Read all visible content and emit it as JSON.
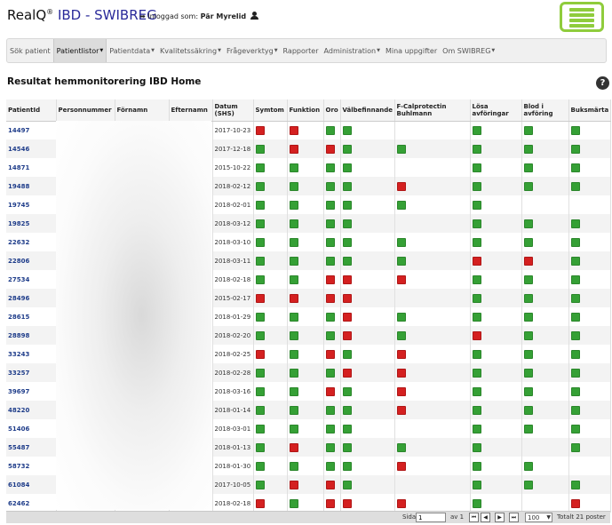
{
  "header": {
    "brand_name": "RealQ",
    "brand_reg": "®",
    "app_name": "IBD - SWIBREG",
    "logged_in_label": "Inloggad som:",
    "user_name": "Pär Myrelid"
  },
  "nav": {
    "items": [
      {
        "label": "Sök patient",
        "dropdown": false
      },
      {
        "label": "Patientlistor",
        "dropdown": true
      },
      {
        "label": "Patientdata",
        "dropdown": true
      },
      {
        "label": "Kvalitetssäkring",
        "dropdown": true
      },
      {
        "label": "Frågeverktyg",
        "dropdown": true
      },
      {
        "label": "Rapporter",
        "dropdown": false
      },
      {
        "label": "Administration",
        "dropdown": true
      },
      {
        "label": "Mina uppgifter",
        "dropdown": false
      },
      {
        "label": "Om SWIBREG",
        "dropdown": true
      }
    ],
    "active_index": 1,
    "caret": "▼"
  },
  "page": {
    "title": "Resultat hemmonitorering IBD Home",
    "help_symbol": "?"
  },
  "table": {
    "headers": [
      "PatientId",
      "Personnummer",
      "Förnamn",
      "Efternamn",
      "Datum (SHS)",
      "Symtom",
      "Funktion",
      "Oro",
      "Välbefinnande",
      "F-Calprotectin Buhlmann",
      "Lösa avföringar",
      "Blod i avföring",
      "Buksmärta"
    ],
    "status_colors": {
      "g": "#35a035",
      "r": "#d42020"
    },
    "rows": [
      {
        "id": "14497",
        "date": "2017-10-23",
        "s": [
          "r",
          "r",
          "g",
          "g",
          "",
          "g",
          "g",
          "g"
        ]
      },
      {
        "id": "14546",
        "date": "2017-12-18",
        "s": [
          "g",
          "r",
          "r",
          "g",
          "g",
          "g",
          "g",
          "g"
        ]
      },
      {
        "id": "14871",
        "date": "2015-10-22",
        "s": [
          "g",
          "g",
          "g",
          "g",
          "",
          "g",
          "g",
          "g"
        ]
      },
      {
        "id": "19488",
        "date": "2018-02-12",
        "s": [
          "g",
          "g",
          "g",
          "g",
          "r",
          "g",
          "g",
          "g"
        ]
      },
      {
        "id": "19745",
        "date": "2018-02-01",
        "s": [
          "g",
          "g",
          "g",
          "g",
          "g",
          "g",
          "",
          ""
        ]
      },
      {
        "id": "19825",
        "date": "2018-03-12",
        "s": [
          "g",
          "g",
          "g",
          "g",
          "",
          "g",
          "g",
          "g"
        ]
      },
      {
        "id": "22632",
        "date": "2018-03-10",
        "s": [
          "g",
          "g",
          "g",
          "g",
          "g",
          "g",
          "g",
          "g"
        ]
      },
      {
        "id": "22806",
        "date": "2018-03-11",
        "s": [
          "g",
          "g",
          "g",
          "g",
          "g",
          "r",
          "r",
          "g"
        ]
      },
      {
        "id": "27534",
        "date": "2018-02-18",
        "s": [
          "g",
          "g",
          "r",
          "r",
          "r",
          "g",
          "g",
          "g"
        ]
      },
      {
        "id": "28496",
        "date": "2015-02-17",
        "s": [
          "r",
          "r",
          "r",
          "r",
          "",
          "g",
          "g",
          "g"
        ]
      },
      {
        "id": "28615",
        "date": "2018-01-29",
        "s": [
          "g",
          "g",
          "g",
          "r",
          "g",
          "g",
          "g",
          "g"
        ]
      },
      {
        "id": "28898",
        "date": "2018-02-20",
        "s": [
          "g",
          "g",
          "g",
          "r",
          "g",
          "r",
          "g",
          "g"
        ]
      },
      {
        "id": "33243",
        "date": "2018-02-25",
        "s": [
          "r",
          "g",
          "r",
          "g",
          "r",
          "g",
          "g",
          "g"
        ]
      },
      {
        "id": "33257",
        "date": "2018-02-28",
        "s": [
          "g",
          "g",
          "g",
          "r",
          "r",
          "g",
          "g",
          "g"
        ]
      },
      {
        "id": "39697",
        "date": "2018-03-16",
        "s": [
          "g",
          "g",
          "r",
          "g",
          "r",
          "g",
          "g",
          "g"
        ]
      },
      {
        "id": "48220",
        "date": "2018-01-14",
        "s": [
          "g",
          "g",
          "g",
          "g",
          "r",
          "g",
          "g",
          "g"
        ]
      },
      {
        "id": "51406",
        "date": "2018-03-01",
        "s": [
          "g",
          "g",
          "g",
          "g",
          "",
          "g",
          "g",
          "g"
        ]
      },
      {
        "id": "55487",
        "date": "2018-01-13",
        "s": [
          "g",
          "r",
          "g",
          "g",
          "g",
          "g",
          "",
          "g"
        ]
      },
      {
        "id": "58732",
        "date": "2018-01-30",
        "s": [
          "g",
          "g",
          "g",
          "g",
          "r",
          "g",
          "g",
          ""
        ]
      },
      {
        "id": "61084",
        "date": "2017-10-05",
        "s": [
          "g",
          "r",
          "r",
          "g",
          "",
          "g",
          "g",
          "g"
        ]
      },
      {
        "id": "62462",
        "date": "2018-02-18",
        "s": [
          "r",
          "g",
          "r",
          "r",
          "r",
          "g",
          "",
          "r"
        ]
      }
    ]
  },
  "pager": {
    "page_label": "Sida",
    "page_value": "1",
    "of_label": "av 1",
    "rows_per_page": "100",
    "total": "Totalt 21 poster",
    "btn_first": "⏮",
    "btn_prev": "◀",
    "btn_next": "▶",
    "btn_last": "⏭"
  }
}
